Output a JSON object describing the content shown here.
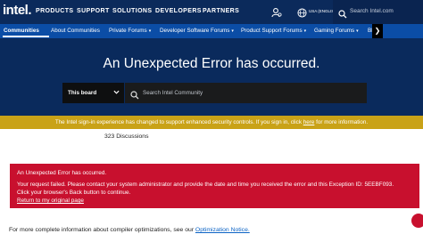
{
  "header": {
    "logo": "intel.",
    "nav": [
      "PRODUCTS",
      "SUPPORT",
      "SOLUTIONS",
      "DEVELOPERS",
      "PARTNERS"
    ],
    "language": "USA (ENGLISH)",
    "search_placeholder": "Search Intel.com"
  },
  "subnav": {
    "items": [
      {
        "label": "Communities",
        "caret": ""
      },
      {
        "label": "About Communities",
        "caret": ""
      },
      {
        "label": "Private Forums",
        "caret": "▾"
      },
      {
        "label": "Developer Software Forums",
        "caret": "▾"
      },
      {
        "label": "Product Support Forums",
        "caret": "▾"
      },
      {
        "label": "Gaming Forums",
        "caret": "▾"
      },
      {
        "label": "Bl",
        "caret": ""
      }
    ],
    "scroll_glyph": "❯"
  },
  "hero": {
    "title": "An Unexpected Error has occurred.",
    "scope_label": "This board",
    "search_placeholder": "Search Intel Community"
  },
  "notice": {
    "text_before": "The Intel sign-in experience has changed to support enhanced security controls. If you sign in, click ",
    "link": "here",
    "text_after": " for more information."
  },
  "discussions": "323 Discussions",
  "error": {
    "title": "An Unexpected Error has occurred.",
    "line1": "Your request failed. Please contact your system administrator and provide the date and time you received the error and this Exception ID: 5EEBF093.",
    "line2": "Click your browser's Back button to continue.",
    "link": "Return to my original page"
  },
  "footnote": {
    "text": "For more complete information about compiler optimizations, see our ",
    "link": "Optimization Notice."
  },
  "colors": {
    "header": "#0b2a5b",
    "subnav": "#0b4da6",
    "hero": "#0a2a5c",
    "notice": "#c9a217",
    "error": "#c8102e",
    "link": "#0b63c5"
  }
}
